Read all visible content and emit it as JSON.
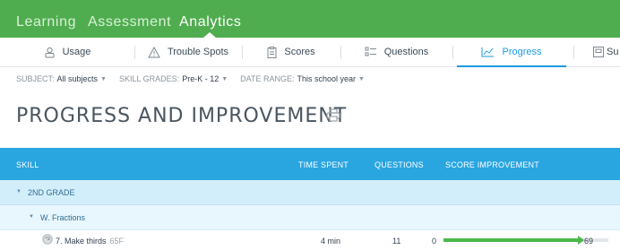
{
  "top_nav": {
    "tabs": [
      {
        "label": "Learning",
        "active": false
      },
      {
        "label": "Assessment",
        "active": false
      },
      {
        "label": "Analytics",
        "active": true
      }
    ]
  },
  "sub_nav": {
    "tabs": [
      {
        "label": "Usage",
        "icon": "usage-icon",
        "active": false
      },
      {
        "label": "Trouble Spots",
        "icon": "warning-icon",
        "active": false
      },
      {
        "label": "Scores",
        "icon": "clipboard-icon",
        "active": false
      },
      {
        "label": "Questions",
        "icon": "questions-icon",
        "active": false
      },
      {
        "label": "Progress",
        "icon": "chart-line-icon",
        "active": true
      },
      {
        "label": "Su",
        "icon": "summary-icon",
        "active": false
      }
    ]
  },
  "filters": {
    "subject": {
      "label": "SUBJECT:",
      "value": "All subjects"
    },
    "skill_grades": {
      "label": "SKILL GRADES:",
      "value": "Pre-K - 12"
    },
    "date_range": {
      "label": "DATE RANGE:",
      "value": "This school year"
    }
  },
  "page": {
    "title": "PROGRESS AND IMPROVEMENT"
  },
  "table": {
    "headers": {
      "skill": "SKILL",
      "time_spent": "TIME SPENT",
      "questions": "QUESTIONS",
      "score_improvement": "SCORE IMPROVEMENT"
    },
    "group": {
      "label": "2ND GRADE"
    },
    "subgroup": {
      "label": "W. Fractions"
    },
    "rows": [
      {
        "skill": "7. Make thirds",
        "code": "65F",
        "time_spent": "4 min",
        "questions": "11",
        "score_start": "0",
        "score_end": "69",
        "improvement_fraction": 0.69
      }
    ]
  },
  "colors": {
    "top_nav_bg": "#4fad4f",
    "accent_blue": "#1e9be0",
    "table_header_bg": "#29a5e0",
    "progress_green": "#4cb84c"
  }
}
